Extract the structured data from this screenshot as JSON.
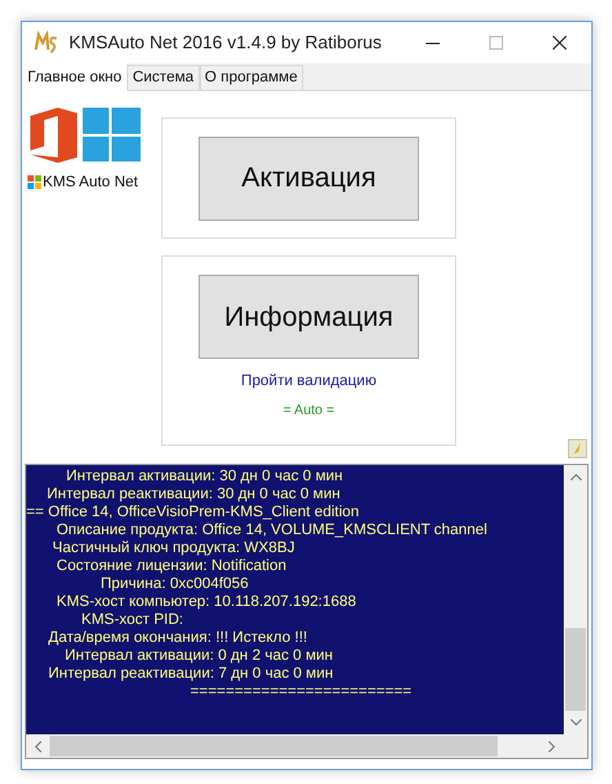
{
  "window": {
    "title": "KMSAuto Net 2016 v1.4.9 by Ratiborus"
  },
  "tabs": [
    {
      "label": "Главное окно",
      "selected": true
    },
    {
      "label": "Система",
      "selected": false
    },
    {
      "label": "О программе",
      "selected": false
    }
  ],
  "logo": {
    "caption": "KMS Auto Net"
  },
  "buttons": [
    "Активация",
    "Информация"
  ],
  "validation_link": "Пройти валидацию",
  "mode": "= Auto =",
  "log": [
    "Интервал активации: 30 дн 0 час 0 мин",
    "Интервал реактивации: 30 дн 0 час 0 мин",
    "== Office 14, OfficeVisioPrem-KMS_Client edition",
    "Описание продукта: Office 14, VOLUME_KMSCLIENT channel",
    "Частичный ключ продукта: WX8BJ",
    "Состояние лицензии: Notification",
    "Причина: 0xc004f056",
    "KMS-хост компьютер: 10.118.207.192:1688",
    "KMS-хост PID:",
    "Дата/время окончания: !!! Истекло !!!",
    "Интервал активации: 0 дн 2 час 0 мин",
    "Интервал реактивации: 7 дн 0 час 0 мин",
    "========================="
  ]
}
